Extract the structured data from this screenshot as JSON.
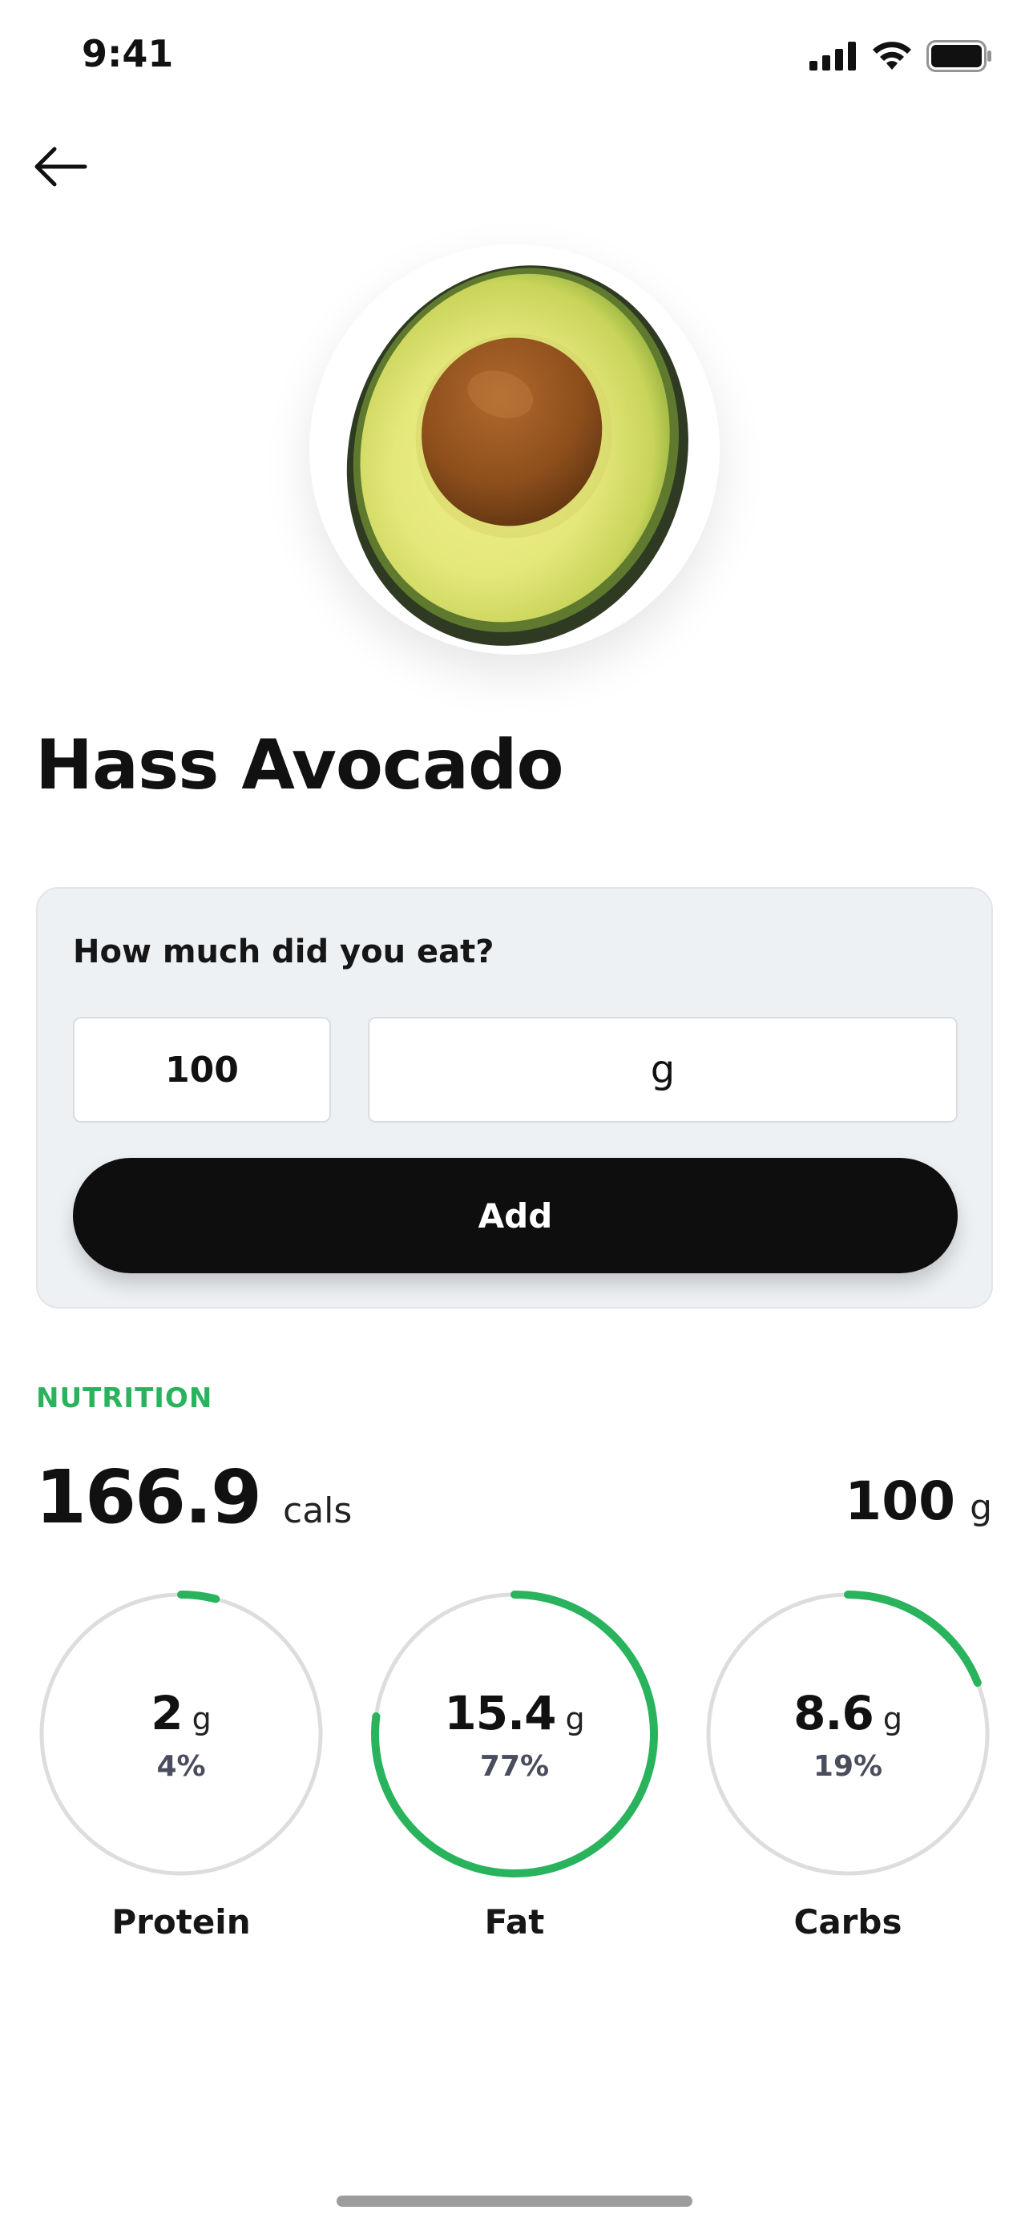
{
  "status_bar": {
    "time": "9:41"
  },
  "food": {
    "name": "Hass Avocado",
    "image_icon": "avocado-half-image"
  },
  "amount": {
    "question": "How much did you eat?",
    "quantity": "100",
    "unit": "g",
    "add_label": "Add"
  },
  "nutrition": {
    "section_label": "NUTRITION",
    "calories": "166.9",
    "calories_unit": "cals",
    "serving_weight": "100",
    "serving_unit": "g",
    "macros": [
      {
        "name": "Protein",
        "value": "2",
        "unit": "g",
        "percent_label": "4%",
        "percent": 4
      },
      {
        "name": "Fat",
        "value": "15.4",
        "unit": "g",
        "percent_label": "77%",
        "percent": 77
      },
      {
        "name": "Carbs",
        "value": "8.6",
        "unit": "g",
        "percent_label": "19%",
        "percent": 19
      }
    ]
  },
  "colors": {
    "accent": "#29b35d",
    "ring_track": "#dddddd",
    "button": "#0e0e0e",
    "card_background": "#eef1f4"
  }
}
